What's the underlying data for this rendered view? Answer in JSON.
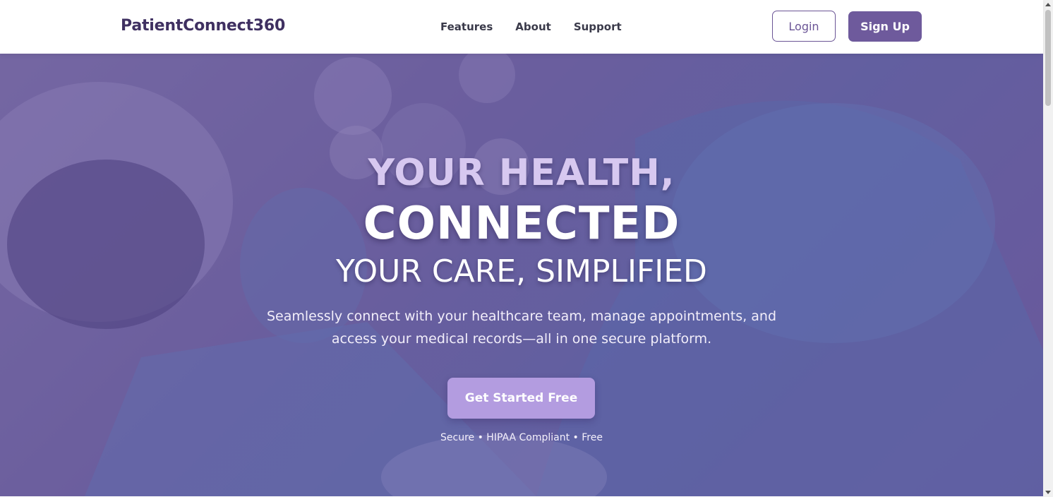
{
  "nav": {
    "logo": "PatientConnect360",
    "links": [
      "Features",
      "About",
      "Support"
    ],
    "login_label": "Login",
    "signup_label": "Sign Up"
  },
  "hero": {
    "line1": "YOUR HEALTH,",
    "line2": "CONNECTED",
    "line3": "YOUR CARE, SIMPLIFIED",
    "description": "Seamlessly connect with your healthcare team, manage appointments, and access your medical records—all in one secure platform.",
    "cta_label": "Get Started Free",
    "trust_text": "Secure • HIPAA Compliant • Free"
  },
  "colors": {
    "brand_purple": "#6e5a9c",
    "logo_color": "#3f3061",
    "cta_lavender": "#b39ce0",
    "headline_lavender": "#d7c8f0"
  },
  "icons": [
    "scroll-up-arrow-icon",
    "scroll-down-arrow-icon"
  ]
}
